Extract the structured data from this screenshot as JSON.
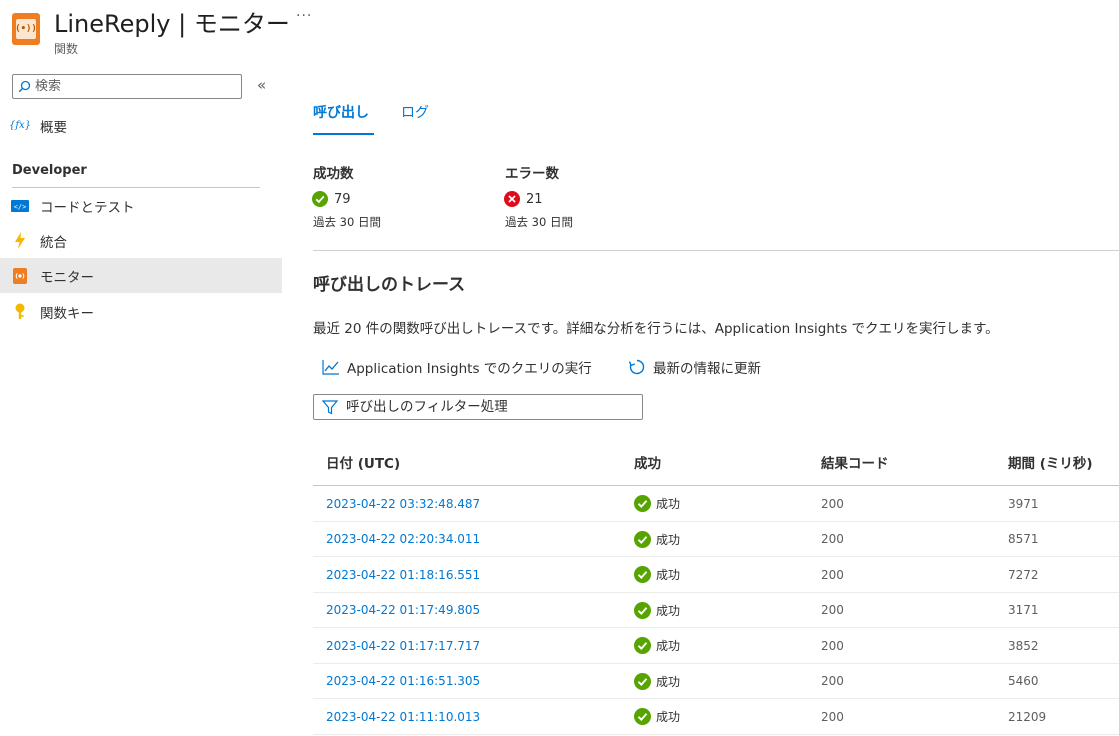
{
  "header": {
    "title": "LineReply | モニター",
    "subtitle": "関数",
    "more": "···",
    "icon_text": "(•))"
  },
  "sidebar": {
    "search_placeholder": "検索",
    "overview": {
      "icon_text": "{fx}",
      "label": "概要"
    },
    "section_label": "Developer",
    "items": [
      {
        "label": "コードとテスト",
        "icon": "code-icon"
      },
      {
        "label": "統合",
        "icon": "lightning-icon"
      },
      {
        "label": "モニター",
        "icon": "monitor-icon",
        "active": true
      },
      {
        "label": "関数キー",
        "icon": "key-icon"
      }
    ]
  },
  "tabs": [
    {
      "label": "呼び出し",
      "active": true
    },
    {
      "label": "ログ",
      "active": false
    }
  ],
  "metrics": {
    "success": {
      "label": "成功数",
      "value": "79",
      "period": "過去 30 日間"
    },
    "errors": {
      "label": "エラー数",
      "value": "21",
      "period": "過去 30 日間"
    }
  },
  "traces": {
    "heading": "呼び出しのトレース",
    "description": "最近 20 件の関数呼び出しトレースです。詳細な分析を行うには、Application Insights でクエリを実行します。",
    "actions": {
      "query": "Application Insights でのクエリの実行",
      "refresh": "最新の情報に更新"
    },
    "filter_placeholder": "呼び出しのフィルター処理",
    "columns": [
      "日付 (UTC)",
      "成功",
      "結果コード",
      "期間 (ミリ秒)"
    ],
    "rows": [
      {
        "date": "2023-04-22 03:32:48.487",
        "success": "成功",
        "code": "200",
        "duration": "3971"
      },
      {
        "date": "2023-04-22 02:20:34.011",
        "success": "成功",
        "code": "200",
        "duration": "8571"
      },
      {
        "date": "2023-04-22 01:18:16.551",
        "success": "成功",
        "code": "200",
        "duration": "7272"
      },
      {
        "date": "2023-04-22 01:17:49.805",
        "success": "成功",
        "code": "200",
        "duration": "3171"
      },
      {
        "date": "2023-04-22 01:17:17.717",
        "success": "成功",
        "code": "200",
        "duration": "3852"
      },
      {
        "date": "2023-04-22 01:16:51.305",
        "success": "成功",
        "code": "200",
        "duration": "5460"
      },
      {
        "date": "2023-04-22 01:11:10.013",
        "success": "成功",
        "code": "200",
        "duration": "21209"
      }
    ]
  },
  "colors": {
    "accent": "#0078d4",
    "success": "#57a300",
    "error": "#e00b1c",
    "app_icon": "#ef7d22"
  }
}
